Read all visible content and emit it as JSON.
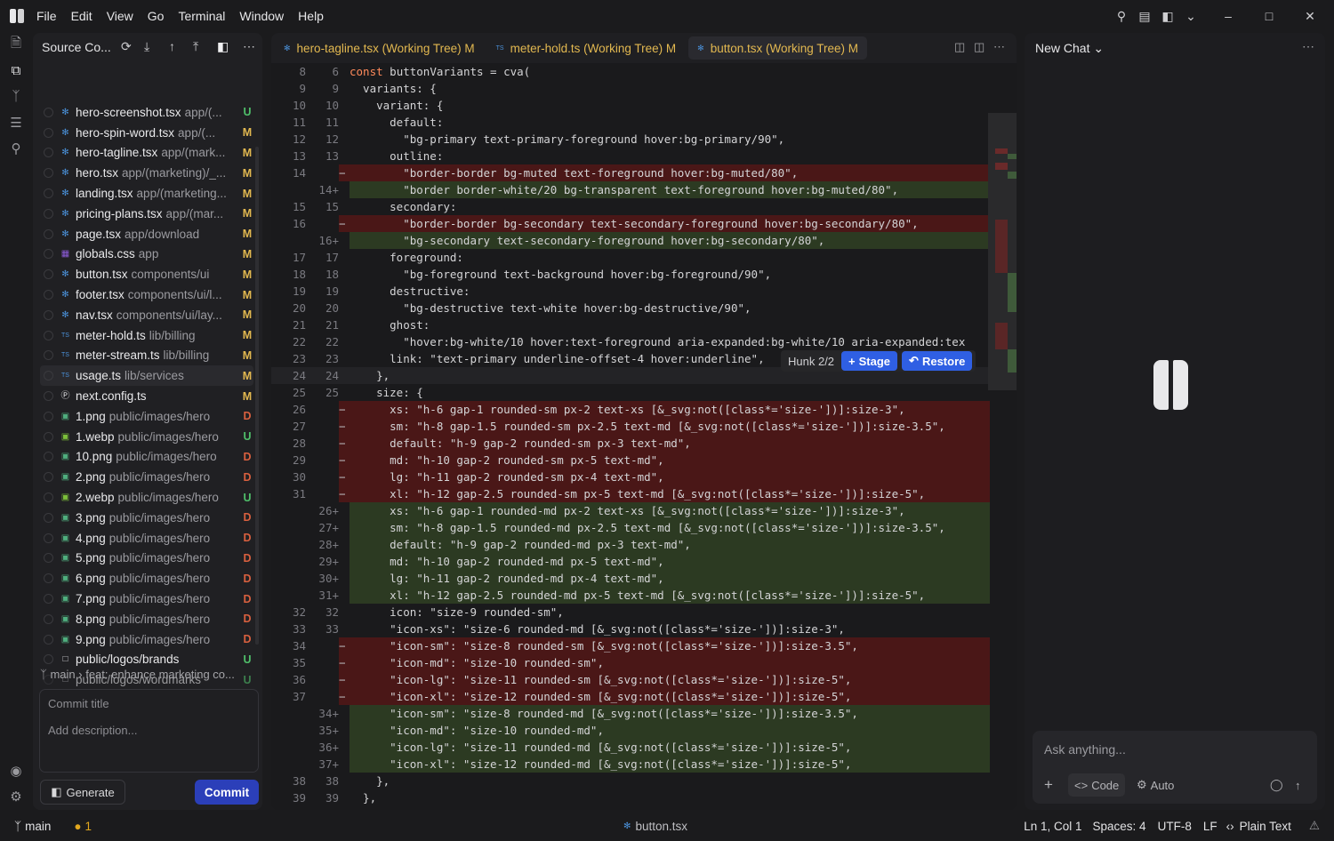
{
  "menubar": {
    "items": [
      "File",
      "Edit",
      "View",
      "Go",
      "Terminal",
      "Window",
      "Help"
    ]
  },
  "sidebar": {
    "title": "Source Co...",
    "files": [
      {
        "name": "hero-screenshot.tsx",
        "path": "app/(...",
        "status": "U",
        "icon": "react"
      },
      {
        "name": "hero-spin-word.tsx",
        "path": "app/(...",
        "status": "M",
        "icon": "react"
      },
      {
        "name": "hero-tagline.tsx",
        "path": "app/(mark...",
        "status": "M",
        "icon": "react"
      },
      {
        "name": "hero.tsx",
        "path": "app/(marketing)/_...",
        "status": "M",
        "icon": "react"
      },
      {
        "name": "landing.tsx",
        "path": "app/(marketing...",
        "status": "M",
        "icon": "react"
      },
      {
        "name": "pricing-plans.tsx",
        "path": "app/(mar...",
        "status": "M",
        "icon": "react"
      },
      {
        "name": "page.tsx",
        "path": "app/download",
        "status": "M",
        "icon": "react"
      },
      {
        "name": "globals.css",
        "path": "app",
        "status": "M",
        "icon": "css"
      },
      {
        "name": "button.tsx",
        "path": "components/ui",
        "status": "M",
        "icon": "react"
      },
      {
        "name": "footer.tsx",
        "path": "components/ui/l...",
        "status": "M",
        "icon": "react"
      },
      {
        "name": "nav.tsx",
        "path": "components/ui/lay...",
        "status": "M",
        "icon": "react"
      },
      {
        "name": "meter-hold.ts",
        "path": "lib/billing",
        "status": "M",
        "icon": "ts"
      },
      {
        "name": "meter-stream.ts",
        "path": "lib/billing",
        "status": "M",
        "icon": "ts"
      },
      {
        "name": "usage.ts",
        "path": "lib/services",
        "status": "M",
        "icon": "ts"
      },
      {
        "name": "next.config.ts",
        "path": "",
        "status": "M",
        "icon": "next"
      },
      {
        "name": "1.png",
        "path": "public/images/hero",
        "status": "D",
        "icon": "img"
      },
      {
        "name": "1.webp",
        "path": "public/images/hero",
        "status": "U",
        "icon": "webp"
      },
      {
        "name": "10.png",
        "path": "public/images/hero",
        "status": "D",
        "icon": "img"
      },
      {
        "name": "2.png",
        "path": "public/images/hero",
        "status": "D",
        "icon": "img"
      },
      {
        "name": "2.webp",
        "path": "public/images/hero",
        "status": "U",
        "icon": "webp"
      },
      {
        "name": "3.png",
        "path": "public/images/hero",
        "status": "D",
        "icon": "img"
      },
      {
        "name": "4.png",
        "path": "public/images/hero",
        "status": "D",
        "icon": "img"
      },
      {
        "name": "5.png",
        "path": "public/images/hero",
        "status": "D",
        "icon": "img"
      },
      {
        "name": "6.png",
        "path": "public/images/hero",
        "status": "D",
        "icon": "img"
      },
      {
        "name": "7.png",
        "path": "public/images/hero",
        "status": "D",
        "icon": "img"
      },
      {
        "name": "8.png",
        "path": "public/images/hero",
        "status": "D",
        "icon": "img"
      },
      {
        "name": "9.png",
        "path": "public/images/hero",
        "status": "D",
        "icon": "img"
      },
      {
        "name": "public/logos/brands",
        "path": "",
        "status": "U",
        "icon": "file"
      },
      {
        "name": "public/logos/wordmarks",
        "path": "",
        "status": "U",
        "icon": "file"
      }
    ],
    "branch": "main",
    "last_commit": "feat: enhance marketing co...",
    "commit_title_placeholder": "Commit title",
    "commit_desc_placeholder": "Add description...",
    "generate_label": "Generate",
    "commit_label": "Commit"
  },
  "editor": {
    "tabs": [
      {
        "label": "hero-tagline.tsx (Working Tree)",
        "mod": "M",
        "icon": "react"
      },
      {
        "label": "meter-hold.ts (Working Tree)",
        "mod": "M",
        "icon": "TS"
      },
      {
        "label": "button.tsx (Working Tree)",
        "mod": "M",
        "icon": "react",
        "active": true
      }
    ],
    "hunk": {
      "label": "Hunk 2/2",
      "stage": "Stage",
      "restore": "Restore"
    },
    "lines": [
      {
        "o": "8",
        "n": "6",
        "m": "",
        "t": "const buttonVariants = cva(",
        "k": "const"
      },
      {
        "o": "9",
        "n": "9",
        "m": "",
        "t": "  variants: {"
      },
      {
        "o": "10",
        "n": "10",
        "m": "",
        "t": "    variant: {"
      },
      {
        "o": "11",
        "n": "11",
        "m": "",
        "t": "      default:"
      },
      {
        "o": "12",
        "n": "12",
        "m": "",
        "t": "        \"bg-primary text-primary-foreground hover:bg-primary/90\","
      },
      {
        "o": "13",
        "n": "13",
        "m": "",
        "t": "      outline:"
      },
      {
        "o": "14",
        "n": "",
        "m": "−",
        "t": "        \"border-border bg-muted text-foreground hover:bg-muted/80\",",
        "type": "del"
      },
      {
        "o": "",
        "n": "14+",
        "m": "",
        "t": "        \"border border-white/20 bg-transparent text-foreground hover:bg-muted/80\",",
        "type": "add"
      },
      {
        "o": "15",
        "n": "15",
        "m": "",
        "t": "      secondary:"
      },
      {
        "o": "16",
        "n": "",
        "m": "−",
        "t": "        \"border-border bg-secondary text-secondary-foreground hover:bg-secondary/80\",",
        "type": "del"
      },
      {
        "o": "",
        "n": "16+",
        "m": "",
        "t": "        \"bg-secondary text-secondary-foreground hover:bg-secondary/80\",",
        "type": "add"
      },
      {
        "o": "17",
        "n": "17",
        "m": "",
        "t": "      foreground:"
      },
      {
        "o": "18",
        "n": "18",
        "m": "",
        "t": "        \"bg-foreground text-background hover:bg-foreground/90\","
      },
      {
        "o": "19",
        "n": "19",
        "m": "",
        "t": "      destructive:"
      },
      {
        "o": "20",
        "n": "20",
        "m": "",
        "t": "        \"bg-destructive text-white hover:bg-destructive/90\","
      },
      {
        "o": "21",
        "n": "21",
        "m": "",
        "t": "      ghost:"
      },
      {
        "o": "22",
        "n": "22",
        "m": "",
        "t": "        \"hover:bg-white/10 hover:text-foreground aria-expanded:bg-white/10 aria-expanded:tex"
      },
      {
        "o": "23",
        "n": "23",
        "m": "",
        "t": "      link: \"text-primary underline-offset-4 hover:underline\","
      },
      {
        "o": "24",
        "n": "24",
        "m": "",
        "t": "    },",
        "type": "curr"
      },
      {
        "o": "25",
        "n": "25",
        "m": "",
        "t": "    size: {"
      },
      {
        "o": "26",
        "n": "",
        "m": "−",
        "t": "      xs: \"h-6 gap-1 rounded-sm px-2 text-xs [&_svg:not([class*='size-'])]:size-3\",",
        "type": "del"
      },
      {
        "o": "27",
        "n": "",
        "m": "−",
        "t": "      sm: \"h-8 gap-1.5 rounded-sm px-2.5 text-md [&_svg:not([class*='size-'])]:size-3.5\",",
        "type": "del"
      },
      {
        "o": "28",
        "n": "",
        "m": "−",
        "t": "      default: \"h-9 gap-2 rounded-sm px-3 text-md\",",
        "type": "del"
      },
      {
        "o": "29",
        "n": "",
        "m": "−",
        "t": "      md: \"h-10 gap-2 rounded-sm px-5 text-md\",",
        "type": "del"
      },
      {
        "o": "30",
        "n": "",
        "m": "−",
        "t": "      lg: \"h-11 gap-2 rounded-sm px-4 text-md\",",
        "type": "del"
      },
      {
        "o": "31",
        "n": "",
        "m": "−",
        "t": "      xl: \"h-12 gap-2.5 rounded-sm px-5 text-md [&_svg:not([class*='size-'])]:size-5\",",
        "type": "del"
      },
      {
        "o": "",
        "n": "26+",
        "m": "",
        "t": "      xs: \"h-6 gap-1 rounded-md px-2 text-xs [&_svg:not([class*='size-'])]:size-3\",",
        "type": "add"
      },
      {
        "o": "",
        "n": "27+",
        "m": "",
        "t": "      sm: \"h-8 gap-1.5 rounded-md px-2.5 text-md [&_svg:not([class*='size-'])]:size-3.5\",",
        "type": "add"
      },
      {
        "o": "",
        "n": "28+",
        "m": "",
        "t": "      default: \"h-9 gap-2 rounded-md px-3 text-md\",",
        "type": "add"
      },
      {
        "o": "",
        "n": "29+",
        "m": "",
        "t": "      md: \"h-10 gap-2 rounded-md px-5 text-md\",",
        "type": "add"
      },
      {
        "o": "",
        "n": "30+",
        "m": "",
        "t": "      lg: \"h-11 gap-2 rounded-md px-4 text-md\",",
        "type": "add"
      },
      {
        "o": "",
        "n": "31+",
        "m": "",
        "t": "      xl: \"h-12 gap-2.5 rounded-md px-5 text-md [&_svg:not([class*='size-'])]:size-5\",",
        "type": "add"
      },
      {
        "o": "32",
        "n": "32",
        "m": "",
        "t": "      icon: \"size-9 rounded-sm\","
      },
      {
        "o": "33",
        "n": "33",
        "m": "",
        "t": "      \"icon-xs\": \"size-6 rounded-md [&_svg:not([class*='size-'])]:size-3\","
      },
      {
        "o": "34",
        "n": "",
        "m": "−",
        "t": "      \"icon-sm\": \"size-8 rounded-sm [&_svg:not([class*='size-'])]:size-3.5\",",
        "type": "del"
      },
      {
        "o": "35",
        "n": "",
        "m": "−",
        "t": "      \"icon-md\": \"size-10 rounded-sm\",",
        "type": "del"
      },
      {
        "o": "36",
        "n": "",
        "m": "−",
        "t": "      \"icon-lg\": \"size-11 rounded-sm [&_svg:not([class*='size-'])]:size-5\",",
        "type": "del"
      },
      {
        "o": "37",
        "n": "",
        "m": "−",
        "t": "      \"icon-xl\": \"size-12 rounded-sm [&_svg:not([class*='size-'])]:size-5\",",
        "type": "del"
      },
      {
        "o": "",
        "n": "34+",
        "m": "",
        "t": "      \"icon-sm\": \"size-8 rounded-md [&_svg:not([class*='size-'])]:size-3.5\",",
        "type": "add"
      },
      {
        "o": "",
        "n": "35+",
        "m": "",
        "t": "      \"icon-md\": \"size-10 rounded-md\",",
        "type": "add"
      },
      {
        "o": "",
        "n": "36+",
        "m": "",
        "t": "      \"icon-lg\": \"size-11 rounded-md [&_svg:not([class*='size-'])]:size-5\",",
        "type": "add"
      },
      {
        "o": "",
        "n": "37+",
        "m": "",
        "t": "      \"icon-xl\": \"size-12 rounded-md [&_svg:not([class*='size-'])]:size-5\",",
        "type": "add"
      },
      {
        "o": "38",
        "n": "38",
        "m": "",
        "t": "    },"
      },
      {
        "o": "39",
        "n": "39",
        "m": "",
        "t": "  },"
      },
      {
        "o": "40",
        "n": "40",
        "m": "",
        "t": "  defaultVariants: {"
      }
    ]
  },
  "chat": {
    "title": "New Chat",
    "placeholder": "Ask anything...",
    "code_label": "Code",
    "auto_label": "Auto"
  },
  "status": {
    "branch": "main",
    "warnings": "1",
    "file": "button.tsx",
    "position": "Ln 1, Col 1",
    "spaces": "Spaces: 4",
    "encoding": "UTF-8",
    "eol": "LF",
    "language": "Plain Text"
  },
  "colors": {
    "modified": "#e2b850",
    "untracked": "#4fbf6a",
    "deleted": "#d9603f",
    "accent": "#2f5fe3"
  }
}
